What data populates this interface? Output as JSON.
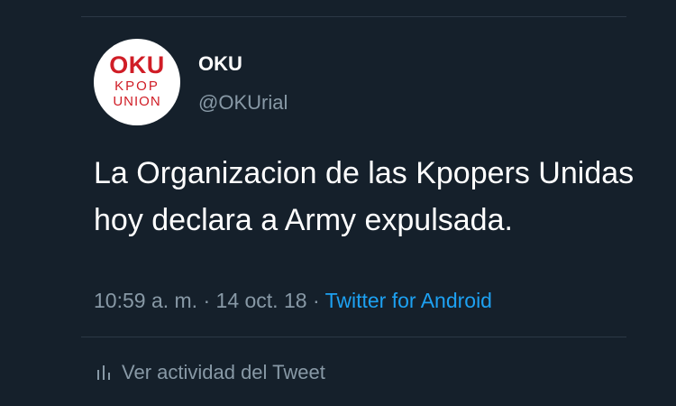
{
  "user": {
    "display_name": "OKU",
    "handle": "@OKUrial",
    "avatar": {
      "logo_line1": "OKU",
      "logo_line2": "KPOP",
      "logo_line3": "UNION",
      "logo_color": "#d01d26"
    }
  },
  "tweet": {
    "text": "La Organizacion de las Kpopers Unidas hoy declara a Army expulsada.",
    "time": "10:59 a. m.",
    "date": "14 oct. 18",
    "separator": "·",
    "source": "Twitter for Android"
  },
  "activity": {
    "label": "Ver actividad del Tweet",
    "icon": "bar-chart-icon"
  },
  "colors": {
    "background": "#15202b",
    "secondary_text": "#8899a6",
    "link": "#1da1f2"
  }
}
